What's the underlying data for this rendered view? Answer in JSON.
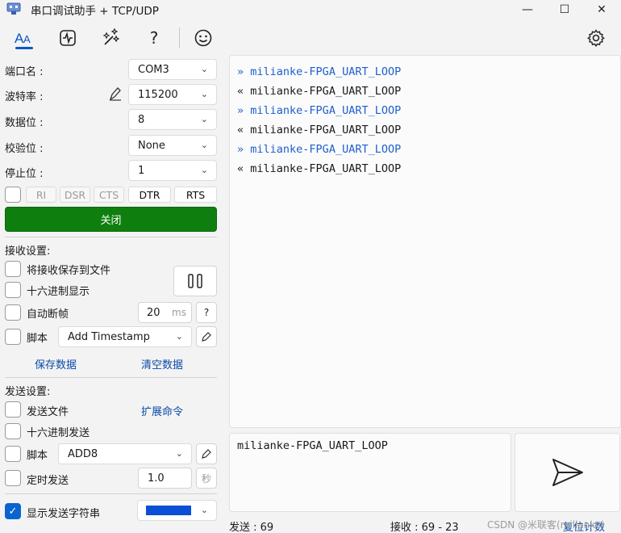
{
  "window": {
    "title": "串口调试助手 + TCP/UDP",
    "minimize": "—",
    "maximize": "☐",
    "close": "✕"
  },
  "toolbar": {
    "icons": [
      "font-icon",
      "oscilloscope-icon",
      "magic-icon",
      "help-icon",
      "smiley-icon",
      "settings-icon"
    ],
    "help_glyph": "?"
  },
  "port": {
    "port_label": "端口名 :",
    "port_value": "COM3",
    "baud_label": "波特率 :",
    "baud_value": "115200",
    "databits_label": "数据位 :",
    "databits_value": "8",
    "parity_label": "校验位 :",
    "parity_value": "None",
    "stopbits_label": "停止位 :",
    "stopbits_value": "1",
    "signals": [
      "RI",
      "DSR",
      "CTS",
      "DTR",
      "RTS"
    ],
    "close_label": "关闭"
  },
  "receive": {
    "title": "接收设置:",
    "save_to_file": "将接收保存到文件",
    "hex_display": "十六进制显示",
    "auto_frame": "自动断帧",
    "frame_value": "20",
    "frame_unit": "ms",
    "frame_help": "?",
    "script_label": "脚本",
    "script_value": "Add Timestamp",
    "save_data": "保存数据",
    "clear_data": "清空数据"
  },
  "send": {
    "title": "发送设置:",
    "send_file": "发送文件",
    "ext_cmd": "扩展命令",
    "hex_send": "十六进制发送",
    "script_label": "脚本",
    "script_value": "ADD8",
    "timed_send": "定时发送",
    "timed_value": "1.0",
    "timed_unit": "秒",
    "show_string": "显示发送字符串",
    "show_checked": "✓",
    "color_swatch": "#0a4fd6"
  },
  "log": [
    {
      "dir": "»",
      "text": "milianke-FPGA_UART_LOOP"
    },
    {
      "dir": "«",
      "text": "milianke-FPGA_UART_LOOP"
    },
    {
      "dir": "»",
      "text": "milianke-FPGA_UART_LOOP"
    },
    {
      "dir": "«",
      "text": "milianke-FPGA_UART_LOOP"
    },
    {
      "dir": "»",
      "text": "milianke-FPGA_UART_LOOP"
    },
    {
      "dir": "«",
      "text": "milianke-FPGA_UART_LOOP"
    }
  ],
  "send_input": {
    "value": "milianke-FPGA_UART_LOOP"
  },
  "status": {
    "sent": "发送 : 69",
    "received": "接收 : 69  -  23",
    "reset": "复位计数",
    "watermark": "CSDN @米联客(milianke)"
  },
  "colors": {
    "accent": "#0a58ca",
    "tx_text": "#1e5fcf",
    "close_button": "#0e7f0e"
  }
}
